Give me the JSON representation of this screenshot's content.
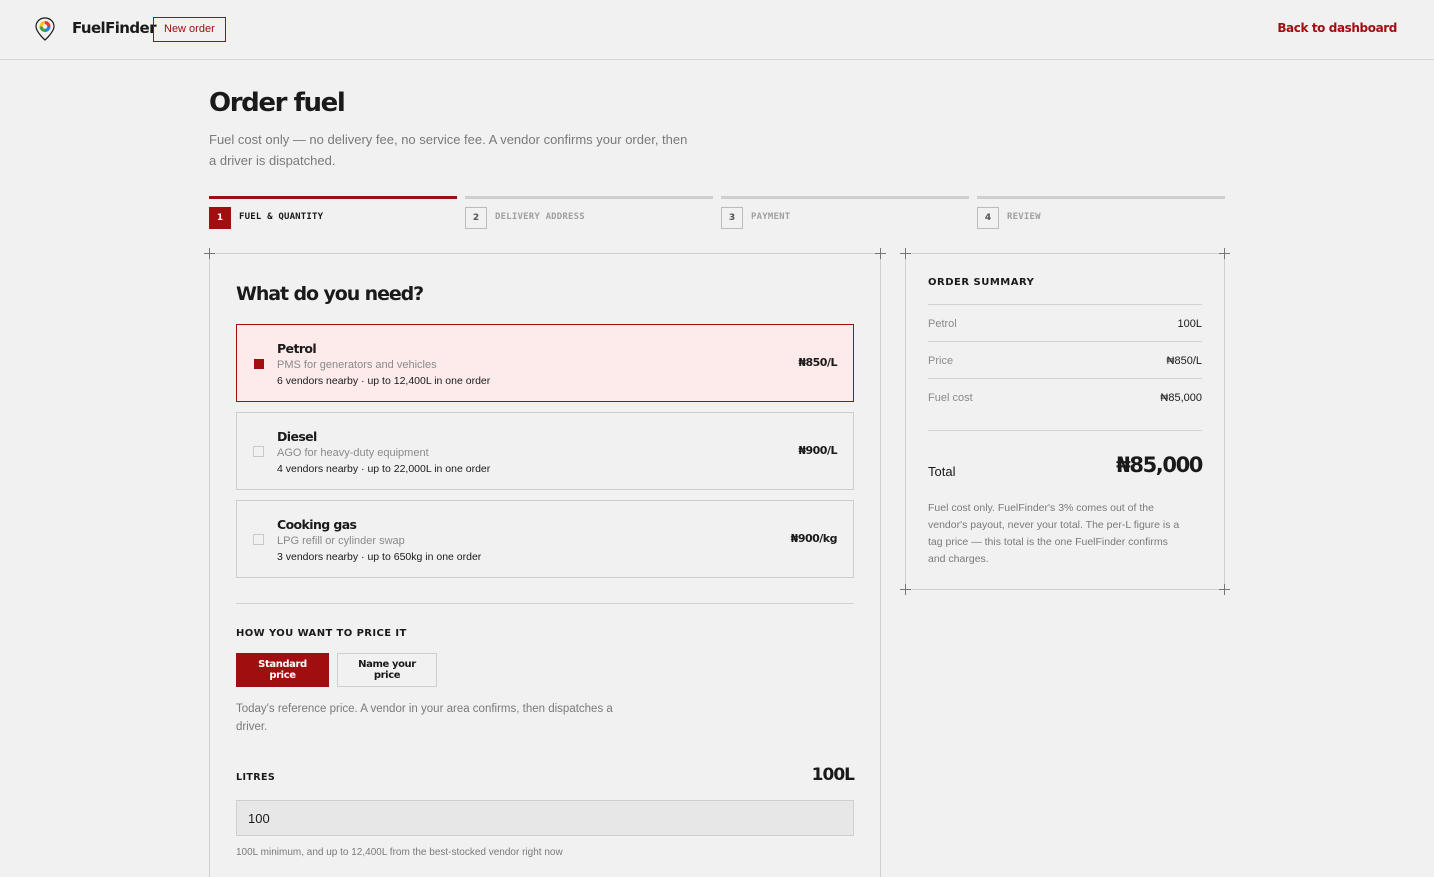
{
  "header": {
    "brand": "FuelFinder",
    "new_order_label": "New order",
    "back_label": "Back to dashboard",
    "logo_icon": "map-pin-logo-icon"
  },
  "hero": {
    "title": "Order fuel",
    "subtitle": "Fuel cost only — no delivery fee, no service fee. A vendor confirms your order, then a driver is dispatched."
  },
  "steps": [
    {
      "num": "1",
      "label": "FUEL & QUANTITY",
      "active": true
    },
    {
      "num": "2",
      "label": "DELIVERY ADDRESS",
      "active": false
    },
    {
      "num": "3",
      "label": "PAYMENT",
      "active": false
    },
    {
      "num": "4",
      "label": "REVIEW",
      "active": false
    }
  ],
  "fuel": {
    "title": "What do you need?",
    "options": [
      {
        "name": "Petrol",
        "desc": "PMS for generators and vehicles",
        "avail": "6 vendors nearby · up to 12,400L in one order",
        "price": "₦850/L",
        "selected": true
      },
      {
        "name": "Diesel",
        "desc": "AGO for heavy-duty equipment",
        "avail": "4 vendors nearby · up to 22,000L in one order",
        "price": "₦900/L",
        "selected": false
      },
      {
        "name": "Cooking gas",
        "desc": "LPG refill or cylinder swap",
        "avail": "3 vendors nearby · up to 650kg in one order",
        "price": "₦900/kg",
        "selected": false
      }
    ]
  },
  "pricing": {
    "heading": "HOW YOU WANT TO PRICE IT",
    "standard_label": "Standard price",
    "name_label": "Name your price",
    "help": "Today's reference price. A vendor in your area confirms, then dispatches a driver."
  },
  "quantity": {
    "heading": "LITRES",
    "display": "100L",
    "value": "100",
    "help": "100L minimum, and up to 12,400L from the best-stocked vendor right now"
  },
  "summary": {
    "title": "ORDER SUMMARY",
    "rows": [
      {
        "k": "Petrol",
        "v": "100L"
      },
      {
        "k": "Price",
        "v": "₦850/L"
      },
      {
        "k": "Fuel cost",
        "v": "₦85,000"
      }
    ],
    "total_label": "Total",
    "total_value": "₦85,000",
    "note": "Fuel cost only. FuelFinder's 3% comes out of the vendor's payout, never your total. The per-L figure is a tag price — this total is the one FuelFinder confirms and charges."
  },
  "colors": {
    "accent": "#a00e10",
    "selected_bg": "#fcebea",
    "page_bg": "#f1f1f1"
  }
}
